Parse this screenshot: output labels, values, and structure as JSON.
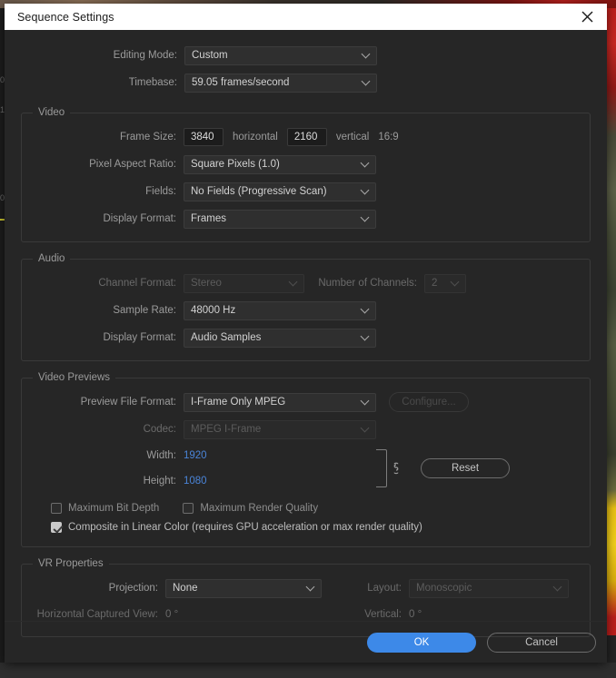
{
  "dialog": {
    "title": "Sequence Settings",
    "close_icon": "close-icon"
  },
  "top": {
    "editing_mode_label": "Editing Mode:",
    "editing_mode_value": "Custom",
    "timebase_label": "Timebase:",
    "timebase_value": "59.05  frames/second"
  },
  "video": {
    "legend": "Video",
    "frame_size_label": "Frame Size:",
    "frame_width_value": "3840",
    "horizontal_text": "horizontal",
    "frame_height_value": "2160",
    "vertical_text": "vertical",
    "aspect_ratio_text": "16:9",
    "pixel_aspect_label": "Pixel Aspect Ratio:",
    "pixel_aspect_value": "Square Pixels (1.0)",
    "fields_label": "Fields:",
    "fields_value": "No Fields (Progressive Scan)",
    "display_format_label": "Display Format:",
    "display_format_value": "Frames"
  },
  "audio": {
    "legend": "Audio",
    "channel_format_label": "Channel Format:",
    "channel_format_value": "Stereo",
    "number_of_channels_label": "Number of Channels:",
    "number_of_channels_value": "2",
    "sample_rate_label": "Sample Rate:",
    "sample_rate_value": "48000 Hz",
    "display_format_label": "Display Format:",
    "display_format_value": "Audio Samples"
  },
  "video_previews": {
    "legend": "Video Previews",
    "preview_file_format_label": "Preview File Format:",
    "preview_file_format_value": "I-Frame Only MPEG",
    "configure_label": "Configure...",
    "codec_label": "Codec:",
    "codec_value": "MPEG I-Frame",
    "width_label": "Width:",
    "width_value": "1920",
    "height_label": "Height:",
    "height_value": "1080",
    "reset_label": "Reset",
    "link_icon": "chain-link-icon",
    "max_bit_depth_label": "Maximum Bit Depth",
    "max_bit_depth_checked": false,
    "max_render_quality_label": "Maximum Render Quality",
    "max_render_quality_checked": false,
    "composite_linear_label": "Composite in Linear Color (requires GPU acceleration or max render quality)",
    "composite_linear_checked": true
  },
  "vr": {
    "legend": "VR Properties",
    "projection_label": "Projection:",
    "projection_value": "None",
    "layout_label": "Layout:",
    "layout_value": "Monoscopic",
    "horizontal_captured_view_label": "Horizontal Captured View:",
    "horizontal_captured_view_value": "0 °",
    "vertical_label": "Vertical:",
    "vertical_value": "0 °"
  },
  "footer": {
    "ok_label": "OK",
    "cancel_label": "Cancel"
  },
  "backdrop": {
    "ruler_ticks": [
      "0",
      "1",
      "0"
    ]
  },
  "colors": {
    "accent_blue": "#3d89e8",
    "value_link_blue": "#4a84d8",
    "dialog_bg": "#262626",
    "titlebar_bg": "#ffffff"
  }
}
